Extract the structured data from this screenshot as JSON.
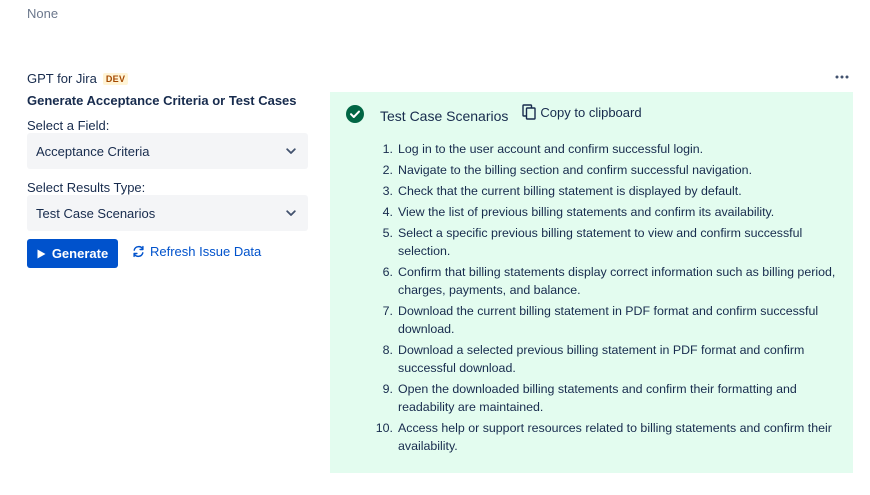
{
  "top_label": "None",
  "app": {
    "name": "GPT for Jira",
    "badge": "DEV",
    "more_icon": "more-horizontal-icon"
  },
  "form": {
    "section_title": "Generate Acceptance Criteria or Test Cases",
    "field_label": "Select a Field:",
    "field_value": "Acceptance Criteria",
    "type_label": "Select Results Type:",
    "type_value": "Test Case Scenarios",
    "generate_label": "Generate",
    "refresh_label": "Refresh Issue Data"
  },
  "result": {
    "title": "Test Case Scenarios",
    "copy_label": "Copy to clipboard",
    "items": [
      {
        "num": "1.",
        "text": "Log in to the user account and confirm successful login."
      },
      {
        "num": "2.",
        "text": "Navigate to the billing section and confirm successful navigation."
      },
      {
        "num": "3.",
        "text": "Check that the current billing statement is displayed by default."
      },
      {
        "num": "4.",
        "text": "View the list of previous billing statements and confirm its availability."
      },
      {
        "num": "5.",
        "text": "Select a specific previous billing statement to view and confirm successful selection."
      },
      {
        "num": "6.",
        "text": "Confirm that billing statements display correct information such as billing period, charges, payments, and balance."
      },
      {
        "num": "7.",
        "text": "Download the current billing statement in PDF format and confirm successful download."
      },
      {
        "num": "8.",
        "text": "Download a selected previous billing statement in PDF format and confirm successful download."
      },
      {
        "num": "9.",
        "text": "Open the downloaded billing statements and confirm their formatting and readability are maintained."
      },
      {
        "num": "10.",
        "text": "Access help or support resources related to billing statements and confirm their availability."
      }
    ]
  },
  "colors": {
    "primary": "#0052cc",
    "success": "#006644",
    "panel_bg": "#e3fcef",
    "select_bg": "#f4f5f7",
    "dev_badge": "#a54800"
  }
}
